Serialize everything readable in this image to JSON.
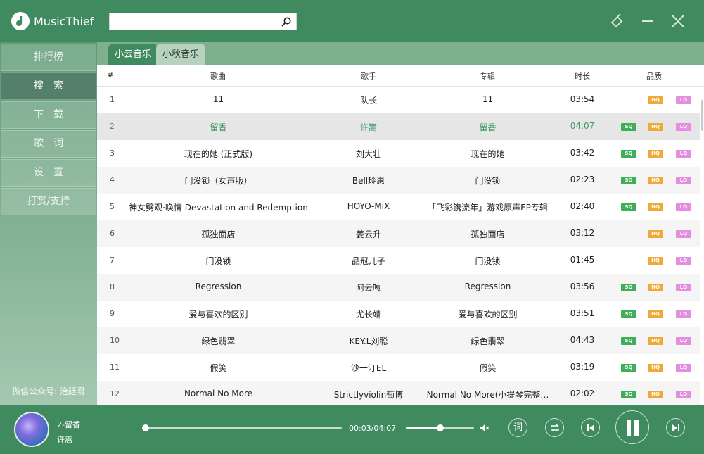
{
  "app": {
    "title": "MusicThief"
  },
  "search": {
    "value": "",
    "placeholder": ""
  },
  "window_controls": [
    "skin-icon",
    "minimize-icon",
    "close-icon"
  ],
  "sidebar": {
    "items": [
      {
        "label": "排行榜",
        "active": false
      },
      {
        "label": "搜　索",
        "active": true
      },
      {
        "label": "下　载",
        "active": false
      },
      {
        "label": "歌　词",
        "active": false
      },
      {
        "label": "设　置",
        "active": false
      },
      {
        "label": "打赏/支持",
        "active": false
      }
    ],
    "footer": "微信公众号: 治廷君"
  },
  "tabs": [
    {
      "label": "小云音乐",
      "active": true
    },
    {
      "label": "小秋音乐",
      "active": false
    }
  ],
  "table": {
    "headers": {
      "index": "#",
      "song": "歌曲",
      "artist": "歌手",
      "album": "专辑",
      "duration": "时长",
      "quality": "品质"
    },
    "badge_labels": {
      "sq": "SQ",
      "hq": "HQ",
      "lq": "LQ"
    },
    "rows": [
      {
        "index": "1",
        "song": "11",
        "artist": "队长",
        "album": "11",
        "duration": "03:54",
        "sq": false,
        "hq": true,
        "lq": true
      },
      {
        "index": "2",
        "song": "留香",
        "artist": "许嵩",
        "album": "留香",
        "duration": "04:07",
        "sq": true,
        "hq": true,
        "lq": true,
        "playing": true
      },
      {
        "index": "3",
        "song": "现在的她 (正式版)",
        "artist": "刘大壮",
        "album": "现在的她",
        "duration": "03:42",
        "sq": true,
        "hq": true,
        "lq": true
      },
      {
        "index": "4",
        "song": "门没锁（女声版）",
        "artist": "Bell玲惠",
        "album": "门没锁",
        "duration": "02:23",
        "sq": true,
        "hq": true,
        "lq": true
      },
      {
        "index": "5",
        "song": "神女劈观·唤情 Devastation and Redemption",
        "artist": "HOYO-MiX",
        "album": "「飞彩镌流年」游戏原声EP专辑",
        "duration": "02:40",
        "sq": true,
        "hq": true,
        "lq": true
      },
      {
        "index": "6",
        "song": "孤独面店",
        "artist": "姜云升",
        "album": "孤独面店",
        "duration": "03:12",
        "sq": false,
        "hq": true,
        "lq": true
      },
      {
        "index": "7",
        "song": "门没锁",
        "artist": "品冠儿子",
        "album": "门没锁",
        "duration": "01:45",
        "sq": false,
        "hq": true,
        "lq": true
      },
      {
        "index": "8",
        "song": "Regression",
        "artist": "阿云嘎",
        "album": "Regression",
        "duration": "03:56",
        "sq": true,
        "hq": true,
        "lq": true
      },
      {
        "index": "9",
        "song": "爱与喜欢的区别",
        "artist": "尤长靖",
        "album": "爱与喜欢的区别",
        "duration": "03:51",
        "sq": true,
        "hq": true,
        "lq": true
      },
      {
        "index": "10",
        "song": "绿色翡翠",
        "artist": "KEY.L刘聪",
        "album": "绿色翡翠",
        "duration": "04:43",
        "sq": true,
        "hq": true,
        "lq": true
      },
      {
        "index": "11",
        "song": "假笑",
        "artist": "沙一汀EL",
        "album": "假笑",
        "duration": "03:19",
        "sq": true,
        "hq": true,
        "lq": true
      },
      {
        "index": "12",
        "song": "Normal No More",
        "artist": "Strictlyviolin萄博",
        "album": "Normal No More(小提琴完整…",
        "duration": "02:02",
        "sq": true,
        "hq": true,
        "lq": true
      }
    ]
  },
  "player": {
    "title": "2-留香",
    "artist": "许嵩",
    "time": "00:03/04:07",
    "progress": 0.01,
    "volume": 0.5,
    "lyrics_button": "词"
  },
  "colors": {
    "brand": "#3f8a5f",
    "playing_text": "#3f9a65",
    "sq": "#3fae5b",
    "hq": "#f0a838",
    "lq": "#e58ee0"
  }
}
